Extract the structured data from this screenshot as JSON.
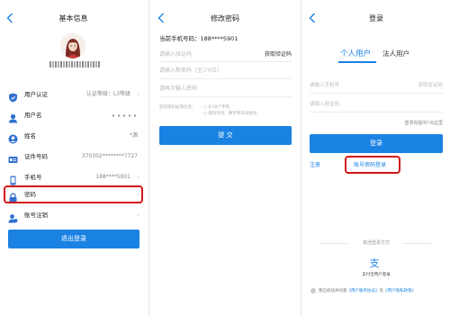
{
  "panel1": {
    "title": "基本信息",
    "rows": [
      {
        "label": "用户认证",
        "value": "认证等级：L3等级"
      },
      {
        "label": "用户名",
        "value": ""
      },
      {
        "label": "姓名",
        "value": "*源"
      },
      {
        "label": "证件号码",
        "value": "370302********7727"
      },
      {
        "label": "手机号",
        "value": "188****5901"
      },
      {
        "label": "密码",
        "value": ""
      },
      {
        "label": "账号注销",
        "value": ""
      }
    ],
    "logout": "退出登录"
  },
  "panel2": {
    "title": "修改密码",
    "phone_label": "当前手机号码：188****5901",
    "code_placeholder": "请输入验证码",
    "get_code": "获取验证码",
    "new_pwd_placeholder": "请输入新密码（至少6位）",
    "confirm_placeholder": "请再次输入密码",
    "hint_label": "您的密码必须包含：",
    "hint_1": "○ 6-18个字符",
    "hint_2": "○ 建议字母、数字和符号组合",
    "submit": "提 交"
  },
  "panel3": {
    "title": "登录",
    "tab_personal": "个人用户",
    "tab_corp": "法人用户",
    "phone_placeholder": "请输入手机号",
    "resend": "获取验证码",
    "code_placeholder": "请输入验证码",
    "issue": "登录有疑问?点这里",
    "login": "登录",
    "register": "注册",
    "pwd_login": "账号密码登录",
    "other_methods": "其他登录方式",
    "alipay": "支付宝用户登录",
    "agree_prefix": "我已阅读并同意",
    "agree_link1": "《用户服务协议》",
    "agree_mid": "及",
    "agree_link2": "《用户隐私政策》"
  },
  "colors": {
    "accent": "#1a82e2",
    "highlight": "#d31616"
  }
}
